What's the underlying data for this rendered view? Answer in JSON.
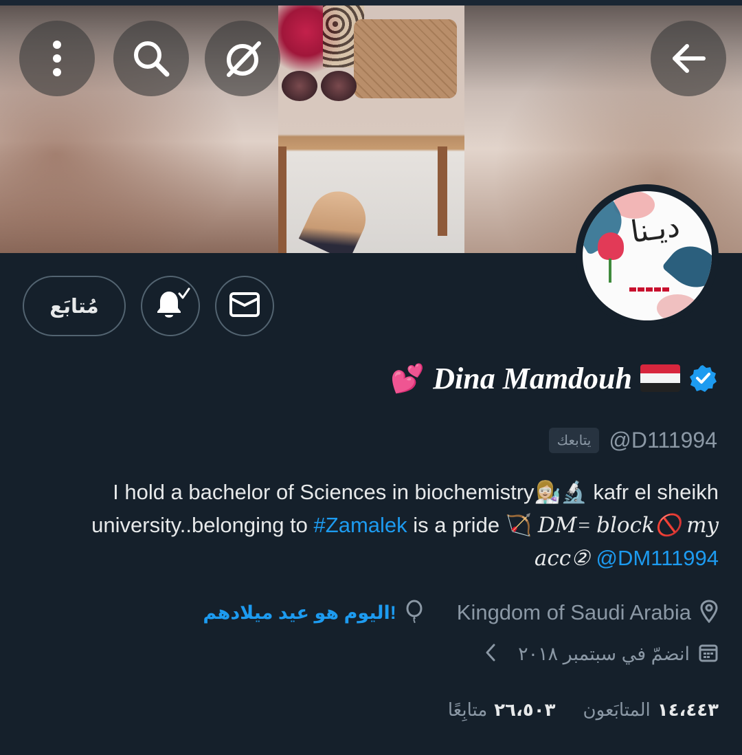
{
  "header": {
    "back_icon": "arrow-left-icon",
    "more_icon": "more-vertical-icon",
    "search_icon": "search-icon",
    "grok_icon": "grok-icon"
  },
  "profile": {
    "name_prefix_emoji": "💕",
    "name": "Dina Mamdouh",
    "handle": "@D111994",
    "follows_you": "يتابعك",
    "bio": {
      "line1": "I hold a bachelor of Sciences in biochemistry👩🏼‍🔬🔬 kafr el sheikh",
      "line2_pre": "university..belonging to ",
      "hashtag": "#Zamalek",
      "line2_mid": " is a pride 🏹",
      "italic_part": "𝐷𝑀= 𝑏𝑙𝑜𝑐𝑘🚫 𝑚𝑦",
      "line3_italic": "𝑎𝑐𝑐②",
      "mention": "@DM111994"
    },
    "location": "Kingdom of Saudi Arabia",
    "birthday_text": "اليوم هو عيد ميلادهم!",
    "joined": "انضمّ في سبتمبر ٢٠١٨",
    "following_count": "١٤،٤٤٣",
    "following_label": "المتابَعون",
    "followers_count": "٢٦،٥٠٣",
    "followers_label": "متابِعًا"
  },
  "actions": {
    "follow_label": "مُتابَع",
    "bell_icon": "bell-check-icon",
    "mail_icon": "mail-icon"
  },
  "colors": {
    "background": "#15202b",
    "accent": "#1d9bf0",
    "muted": "#8b98a5",
    "text": "#e7e9ea"
  }
}
